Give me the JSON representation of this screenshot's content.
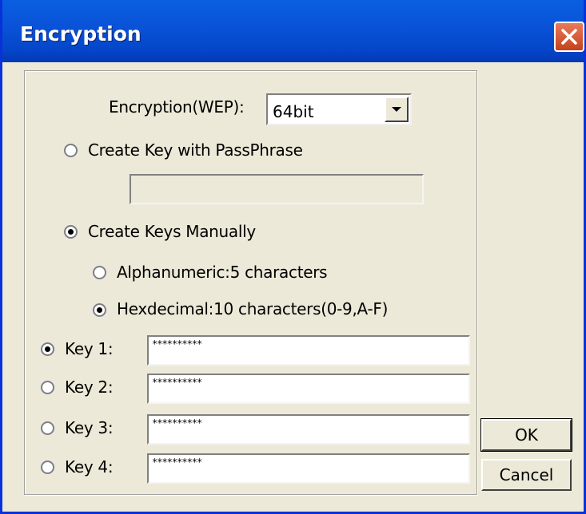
{
  "window": {
    "title": "Encryption"
  },
  "encryption": {
    "label": "Encryption(WEP):",
    "selected": "64bit"
  },
  "passphrase": {
    "radio_label": "Create Key with PassPhrase",
    "value": ""
  },
  "manual": {
    "radio_label": "Create Keys Manually",
    "alphanumeric_label": "Alphanumeric:5 characters",
    "hexdecimal_label": "Hexdecimal:10 characters(0-9,A-F)"
  },
  "keys": [
    {
      "label": "Key 1:",
      "value": "**********",
      "selected": true
    },
    {
      "label": "Key 2:",
      "value": "**********",
      "selected": false
    },
    {
      "label": "Key 3:",
      "value": "**********",
      "selected": false
    },
    {
      "label": "Key 4:",
      "value": "**********",
      "selected": false
    }
  ],
  "buttons": {
    "ok": "OK",
    "cancel": "Cancel"
  },
  "colors": {
    "titlebar": "#0a53d8",
    "dialog_bg": "#ece9d8",
    "close": "#c3431c"
  },
  "icons": {
    "close": "close-icon",
    "dropdown": "chevron-down-icon"
  }
}
